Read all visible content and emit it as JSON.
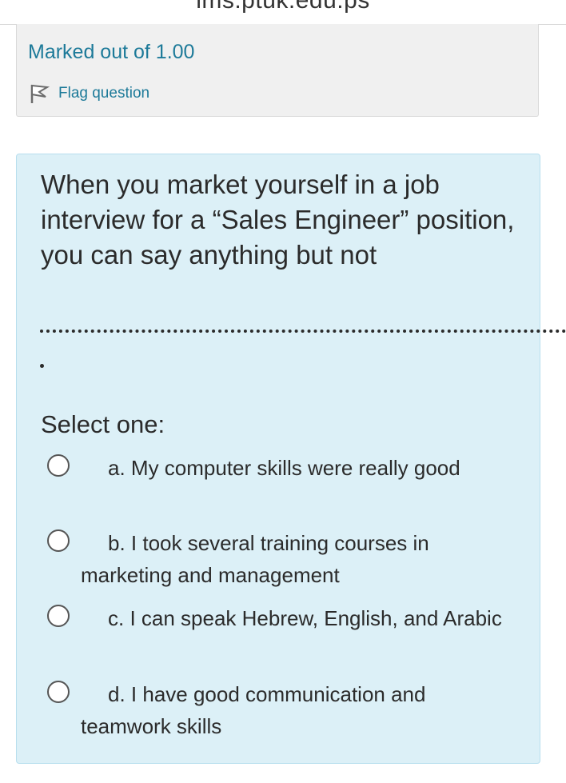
{
  "browser": {
    "url": "lms.ptuk.edu.ps"
  },
  "info": {
    "marked": "Marked out of 1.00",
    "flag_label": "Flag question"
  },
  "question": {
    "text": "When you market yourself in a job interview for a “Sales Engineer” position, you can say anything but not",
    "select_label": "Select one:",
    "options": [
      {
        "label": "a. My computer skills were really good"
      },
      {
        "label": "b. I took several training courses in marketing and management"
      },
      {
        "label": "c. I can speak Hebrew, English, and Arabic"
      },
      {
        "label": "d. I have good communication and teamwork skills"
      }
    ]
  },
  "colors": {
    "link": "#1d7a99",
    "question_bg": "#dcf0f7",
    "info_bg": "#f0f0f0"
  }
}
